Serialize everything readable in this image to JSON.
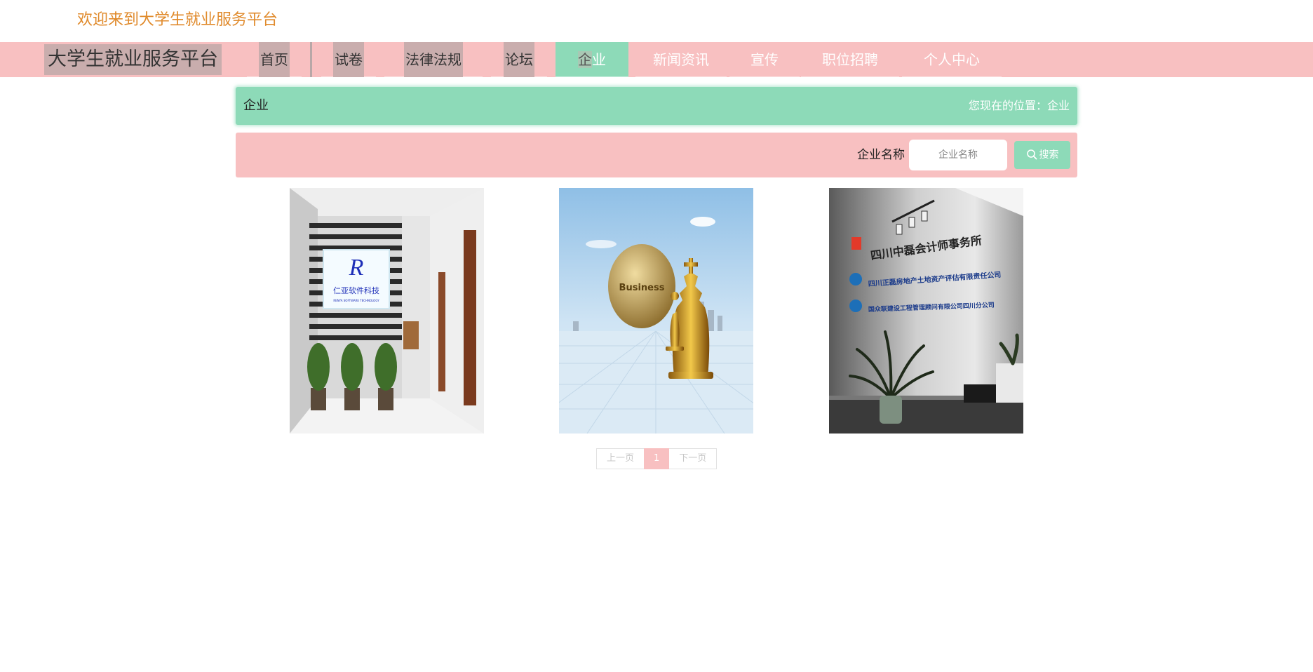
{
  "header": {
    "welcome": "欢迎来到大学生就业服务平台"
  },
  "nav": {
    "brand": "大学生就业服务平台",
    "items": [
      {
        "label": "首页"
      },
      {
        "label": "试卷"
      },
      {
        "label": "法律法规"
      },
      {
        "label": "论坛"
      },
      {
        "label": "企业"
      },
      {
        "label": "新闻资讯"
      },
      {
        "label": "宣传"
      },
      {
        "label": "职位招聘"
      },
      {
        "label": "个人中心"
      }
    ],
    "active_index": 4
  },
  "breadcrumb": {
    "title": "企业",
    "location": "您现在的位置：企业"
  },
  "search": {
    "label": "企业名称",
    "placeholder": "企业名称",
    "button": "搜索"
  },
  "companies": [
    {
      "sign_name": "仁亚软件科技",
      "sign_sub": "RENYA SOFTWARE TECHNOLOGY"
    },
    {
      "caption": "Business"
    },
    {
      "sign_lines": [
        "四川中磊会计师事务所",
        "四川正磊房地产土地资产评估有限责任公司",
        "国众联建设工程管理顾问有限公司四川分公司"
      ]
    }
  ],
  "pagination": {
    "prev": "上一页",
    "current": "1",
    "next": "下一页"
  },
  "colors": {
    "pink": "#f8c0c1",
    "green": "#8ddab8",
    "welcome": "#e08a2b"
  }
}
